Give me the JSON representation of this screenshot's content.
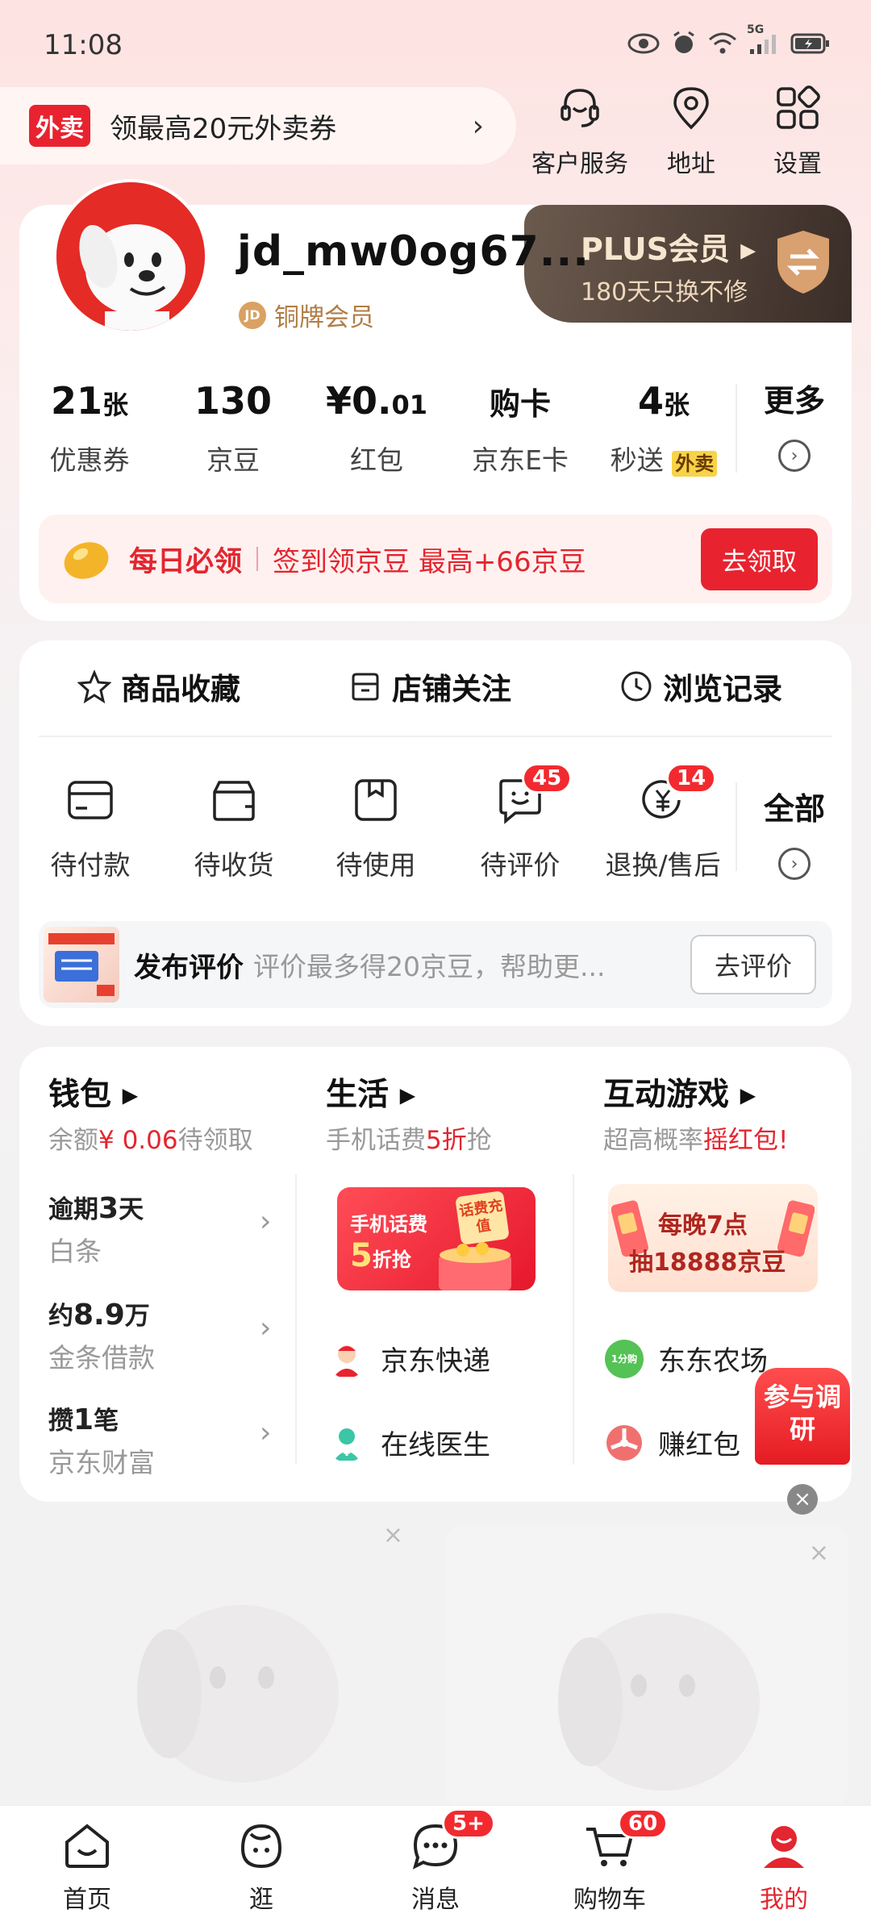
{
  "status_bar": {
    "time": "11:08",
    "network": "5G"
  },
  "promo": {
    "badge": "外卖",
    "text": "领最高20元外卖券",
    "arrow": "›"
  },
  "top_actions": [
    {
      "label": "客户服务",
      "icon": "headset-icon"
    },
    {
      "label": "地址",
      "icon": "location-pin-icon"
    },
    {
      "label": "设置",
      "icon": "grid-settings-icon"
    }
  ],
  "profile": {
    "username": "jd_mw0og67...",
    "member_level": "铜牌会员",
    "member_coin": "JD"
  },
  "plus": {
    "title": "PLUS会员 ▸",
    "subtitle": "180天只换不修"
  },
  "assets": [
    {
      "value": "21",
      "unit": "张",
      "label": "优惠券"
    },
    {
      "value": "130",
      "unit": "",
      "label": "京豆"
    },
    {
      "value": "¥0.",
      "unit": "01",
      "label": "红包"
    },
    {
      "value": "购卡",
      "unit": "",
      "label": "京东E卡"
    },
    {
      "value": "4",
      "unit": "张",
      "label": "秒送",
      "tag": "外卖"
    }
  ],
  "assets_more": "更多",
  "daily": {
    "title": "每日必领",
    "text": "签到领京豆 最高+66京豆",
    "button": "去领取"
  },
  "favorites": [
    {
      "label": "商品收藏",
      "icon": "star-icon"
    },
    {
      "label": "店铺关注",
      "icon": "shop-icon"
    },
    {
      "label": "浏览记录",
      "icon": "clock-icon"
    }
  ],
  "orders": [
    {
      "label": "待付款",
      "icon": "wallet-card-icon",
      "badge": ""
    },
    {
      "label": "待收货",
      "icon": "package-icon",
      "badge": ""
    },
    {
      "label": "待使用",
      "icon": "ticket-box-icon",
      "badge": ""
    },
    {
      "label": "待评价",
      "icon": "comment-smile-icon",
      "badge": "45"
    },
    {
      "label": "退换/售后",
      "icon": "refund-icon",
      "badge": "14"
    }
  ],
  "orders_all": "全部",
  "review": {
    "title": "发布评价",
    "text": "评价最多得20京豆，帮助更...",
    "button": "去评价"
  },
  "wallet": {
    "title": "钱包",
    "sub_prefix": "余额",
    "sub_amount": "¥ 0.06",
    "sub_suffix": "待领取",
    "rows": [
      {
        "a_pre": "逾期",
        "a_big": "3",
        "a_post": "天",
        "b": "白条"
      },
      {
        "a_pre": "约",
        "a_big": "8.9",
        "a_post": "万",
        "b": "金条借款"
      },
      {
        "a_pre": "攒",
        "a_big": "1",
        "a_post": "笔",
        "b": "京东财富"
      }
    ]
  },
  "life": {
    "title": "生活",
    "sub_prefix": "手机话费",
    "sub_red": "5折",
    "sub_suffix": "抢",
    "banner_line1": "手机话费",
    "banner_num": "5",
    "banner_line2": "折抢",
    "banner_tag": "话费充值",
    "items": [
      {
        "label": "京东快递"
      },
      {
        "label": "在线医生"
      }
    ]
  },
  "games": {
    "title": "互动游戏",
    "sub_prefix": "超高概率",
    "sub_red": "摇红包!",
    "banner_line1": "每晚7点",
    "banner_line2": "抽18888京豆",
    "items": [
      {
        "label": "东东农场",
        "tag": "1分购"
      },
      {
        "label": "赚红包"
      }
    ]
  },
  "survey": {
    "text": "参与调研",
    "close": "×"
  },
  "placeholders": {
    "close": "×"
  },
  "tabs": [
    {
      "label": "首页",
      "icon": "home-icon",
      "badge": ""
    },
    {
      "label": "逛",
      "icon": "explore-face-icon",
      "badge": ""
    },
    {
      "label": "消息",
      "icon": "message-icon",
      "badge": "5+"
    },
    {
      "label": "购物车",
      "icon": "cart-icon",
      "badge": "60"
    },
    {
      "label": "我的",
      "icon": "profile-icon",
      "badge": "",
      "active": true
    }
  ],
  "colors": {
    "brand_red": "#e3262f",
    "plus_gold": "#f2dfc6",
    "badge_red": "#f22a2f"
  }
}
